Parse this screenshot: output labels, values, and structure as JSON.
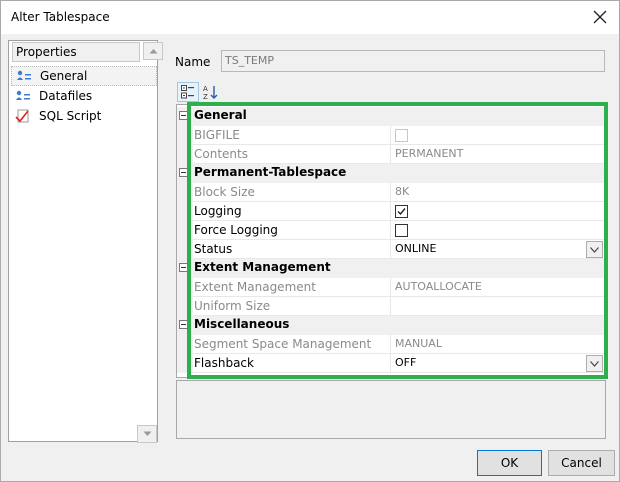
{
  "window": {
    "title": "Alter Tablespace"
  },
  "left_panel": {
    "header": "Properties",
    "items": [
      {
        "label": "General",
        "icon": "general-properties-icon",
        "selected": true
      },
      {
        "label": "Datafiles",
        "icon": "datafiles-icon",
        "selected": false
      },
      {
        "label": "SQL Script",
        "icon": "sql-script-icon",
        "selected": false
      }
    ]
  },
  "name_field": {
    "label": "Name",
    "value": "TS_TEMP"
  },
  "toolbar": {
    "categorized_icon": "categorized-view-icon",
    "sort_icon": "alphabetical-sort-icon"
  },
  "grid": {
    "categories": [
      {
        "label": "General",
        "rows": [
          {
            "name": "BIGFILE",
            "value": "",
            "type": "checkbox",
            "checked": false,
            "disabled": true
          },
          {
            "name": "Contents",
            "value": "PERMANENT",
            "type": "text",
            "disabled": true
          }
        ]
      },
      {
        "label": "Permanent-Tablespace",
        "rows": [
          {
            "name": "Block Size",
            "value": "8K",
            "type": "text",
            "disabled": true
          },
          {
            "name": "Logging",
            "value": "",
            "type": "checkbox",
            "checked": true,
            "disabled": false
          },
          {
            "name": "Force Logging",
            "value": "",
            "type": "checkbox",
            "checked": false,
            "disabled": false
          },
          {
            "name": "Status",
            "value": "ONLINE",
            "type": "dropdown",
            "disabled": false
          }
        ]
      },
      {
        "label": "Extent Management",
        "rows": [
          {
            "name": "Extent Management",
            "value": "AUTOALLOCATE",
            "type": "text",
            "disabled": true
          },
          {
            "name": "Uniform Size",
            "value": "",
            "type": "text",
            "disabled": true
          }
        ]
      },
      {
        "label": "Miscellaneous",
        "rows": [
          {
            "name": "Segment Space Management",
            "value": "MANUAL",
            "type": "text",
            "disabled": true
          },
          {
            "name": "Flashback",
            "value": "OFF",
            "type": "dropdown",
            "disabled": false
          }
        ]
      }
    ]
  },
  "buttons": {
    "ok": "OK",
    "cancel": "Cancel"
  },
  "colors": {
    "highlight": "#2eaf4e",
    "accent": "#0078d7",
    "disabled_text": "#8a8a8a"
  }
}
